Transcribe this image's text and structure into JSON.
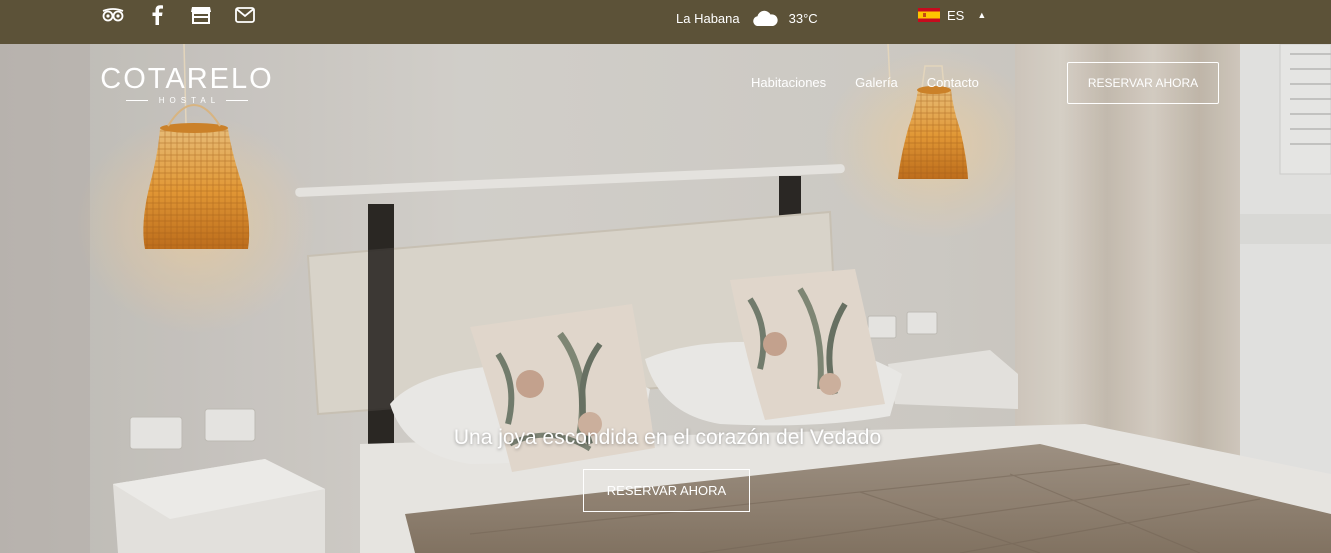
{
  "topbar": {
    "social": [
      {
        "icon": "tripadvisor-icon"
      },
      {
        "icon": "facebook-icon"
      },
      {
        "icon": "store-icon"
      },
      {
        "icon": "envelope-icon"
      }
    ],
    "weather": {
      "city": "La Habana",
      "icon": "cloud-icon",
      "temperature": "33°C"
    },
    "language": {
      "flag": "spain-flag-icon",
      "code": "ES",
      "caret": "▲"
    }
  },
  "header": {
    "logo": {
      "name": "COTARELO",
      "subtitle": "HOSTAL"
    },
    "nav": [
      "Habitaciones",
      "Galería",
      "Contacto"
    ],
    "cta": "RESERVAR AHORA"
  },
  "hero": {
    "tagline": "Una joya escondida en el corazón del Vedado",
    "cta": "RESERVAR AHORA"
  },
  "colors": {
    "topbar": "#5c5238",
    "wall": "#dcdad6",
    "lamp": "#f0a23a",
    "headboard": "#e6e1d6",
    "throw": "#9a8a78"
  }
}
